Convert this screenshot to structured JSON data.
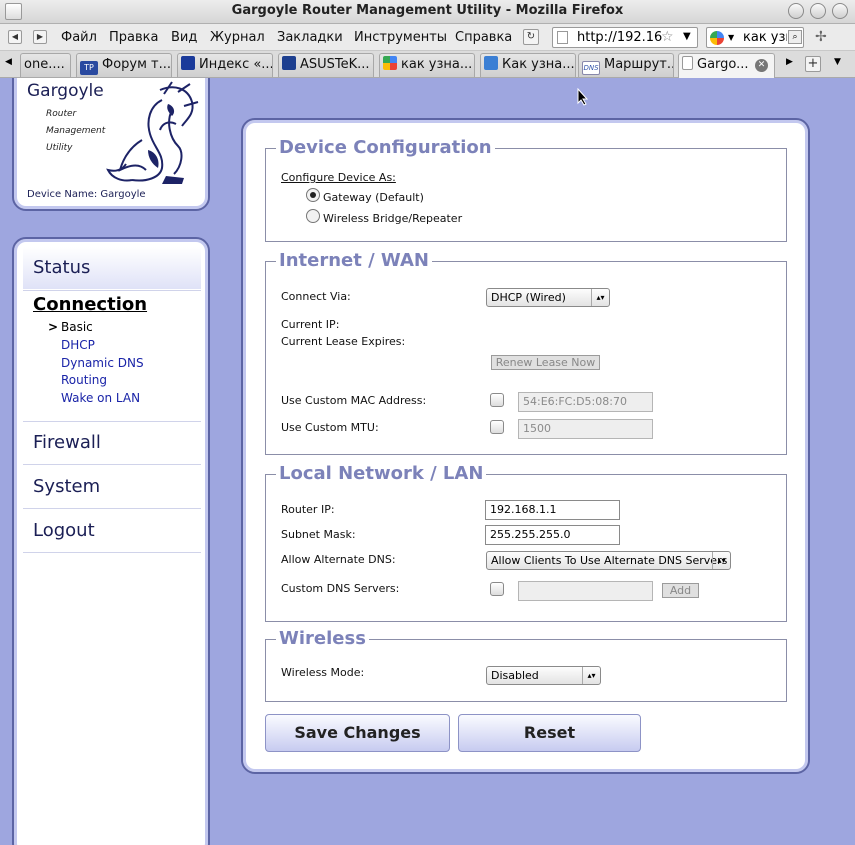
{
  "window": {
    "title": "Gargoyle Router Management Utility - Mozilla Firefox"
  },
  "menu": {
    "items": [
      "Файл",
      "Правка",
      "Вид",
      "Журнал",
      "Закладки",
      "Инструменты",
      "Справка"
    ]
  },
  "urlbar": {
    "url": "http://192.16"
  },
  "searchbar": {
    "text": "как узн"
  },
  "tabs": [
    {
      "label": "one...."
    },
    {
      "label": "Форум т..."
    },
    {
      "label": "Индекс «..."
    },
    {
      "label": "ASUSTeK..."
    },
    {
      "label": "как узна..."
    },
    {
      "label": "Как узна..."
    },
    {
      "label": "Маршрут..."
    },
    {
      "label": "Gargo..."
    }
  ],
  "logo": {
    "title": "Gargoyle",
    "line1": "Router",
    "line2": "Management",
    "line3": "Utility",
    "device_name": "Device Name: Gargoyle"
  },
  "nav": {
    "status": "Status",
    "connection": "Connection",
    "sub_marker": ">",
    "sub": [
      "Basic",
      "DHCP",
      "Dynamic DNS",
      "Routing",
      "Wake on LAN"
    ],
    "firewall": "Firewall",
    "system": "System",
    "logout": "Logout"
  },
  "device_config": {
    "legend": "Device Configuration",
    "configure_label": "Configure Device As:",
    "gateway": "Gateway (Default)",
    "bridge": "Wireless Bridge/Repeater"
  },
  "wan": {
    "legend": "Internet / WAN",
    "connect_via_label": "Connect Via:",
    "connect_via_value": "DHCP (Wired)",
    "current_ip_label": "Current IP:",
    "lease_label": "Current Lease Expires:",
    "renew_button": "Renew Lease Now",
    "mac_label": "Use Custom MAC Address:",
    "mac_value": "54:E6:FC:D5:08:70",
    "mtu_label": "Use Custom MTU:",
    "mtu_value": "1500"
  },
  "lan": {
    "legend": "Local Network / LAN",
    "router_ip_label": "Router IP:",
    "router_ip_value": "192.168.1.1",
    "subnet_label": "Subnet Mask:",
    "subnet_value": "255.255.255.0",
    "alt_dns_label": "Allow Alternate DNS:",
    "alt_dns_value": "Allow Clients To Use Alternate DNS Servers",
    "custom_dns_label": "Custom DNS Servers:",
    "add_button": "Add"
  },
  "wireless": {
    "legend": "Wireless",
    "mode_label": "Wireless Mode:",
    "mode_value": "Disabled"
  },
  "actions": {
    "save": "Save Changes",
    "reset": "Reset"
  },
  "colors": {
    "page_bg": "#9ea6df",
    "panel_border": "#5c64a4",
    "legend": "#7c82b9",
    "nav_text": "#1b1f55",
    "link": "#1a24a8"
  }
}
